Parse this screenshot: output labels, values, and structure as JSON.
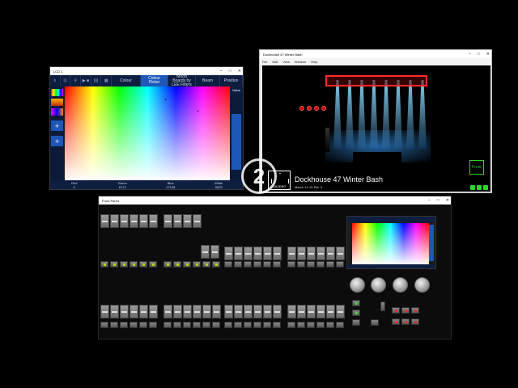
{
  "lcd": {
    "title": "LCD 1",
    "controls": [
      "–",
      "□",
      "✕"
    ],
    "toolbar_buttons": [
      "≡",
      "⊡",
      "⚲",
      "▶ ■",
      "||||",
      "▦"
    ],
    "tabs": [
      "Colour",
      "Colour Picker",
      "Mood Boards by LEE Filters",
      "Beam",
      "Position"
    ],
    "active_tab": "Colour Picker",
    "value_label": "Value",
    "value_level": 0.77,
    "plus_label": "+",
    "readouts": [
      {
        "name": "Red",
        "value": "0"
      },
      {
        "name": "Green",
        "value": "6172"
      },
      {
        "name": "Blue",
        "value": "27138"
      },
      {
        "name": "White",
        "value": "5525"
      }
    ]
  },
  "visualizer": {
    "title": "Dockhouse 47 Winter Bash",
    "menu": [
      "File",
      "Edit",
      "View",
      "Window",
      "Help"
    ],
    "show_title": "Dockhouse 47 Winter Bash",
    "show_subtitle": "March 12-15 Pier 3",
    "logo_text": "GAZEBO",
    "front_button": "Front",
    "controls": [
      "–",
      "□",
      "✕"
    ]
  },
  "badge": {
    "text": "2"
  },
  "front_panel": {
    "title": "Front Panel",
    "controls": [
      "–",
      "□",
      "✕"
    ]
  }
}
